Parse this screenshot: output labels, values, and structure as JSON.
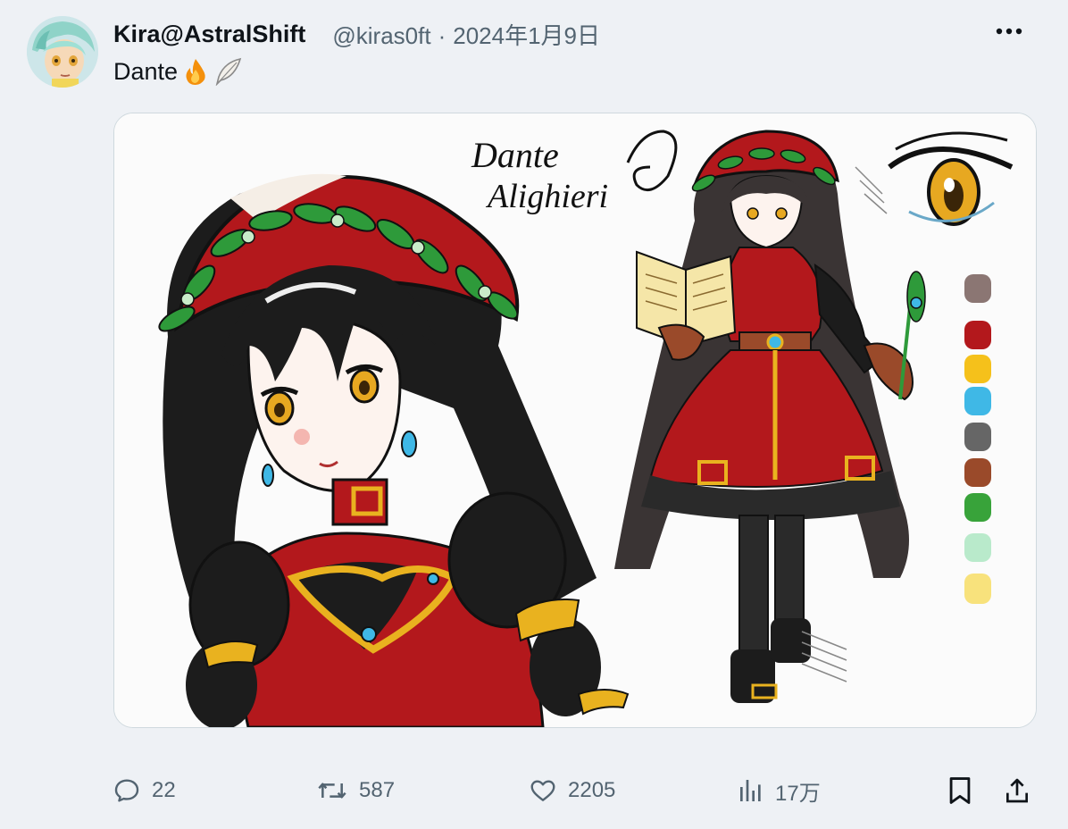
{
  "post": {
    "display_name": "Kira@AstralShift",
    "handle": "@kiras0ft",
    "separator": "·",
    "date": "2024年1月9日",
    "text": "Dante",
    "text_emoji": [
      "fire-emoji",
      "feather-emoji"
    ]
  },
  "media": {
    "handwritten_title_line1": "Dante",
    "handwritten_title_line2": "Alighieri",
    "palette_swatches": [
      "#8b7673",
      "#b3181c",
      "#f5c11b",
      "#3fb8e6",
      "#666666",
      "#9a4a2a",
      "#38a33a",
      "#b9eacb",
      "#f8e27c"
    ]
  },
  "actions": {
    "reply_count": "22",
    "repost_count": "587",
    "like_count": "2205",
    "views_count": "17万"
  },
  "colors": {
    "text_primary": "#0f1419",
    "text_secondary": "#536471",
    "page_bg": "#eef1f5",
    "border": "#cfd9de"
  }
}
